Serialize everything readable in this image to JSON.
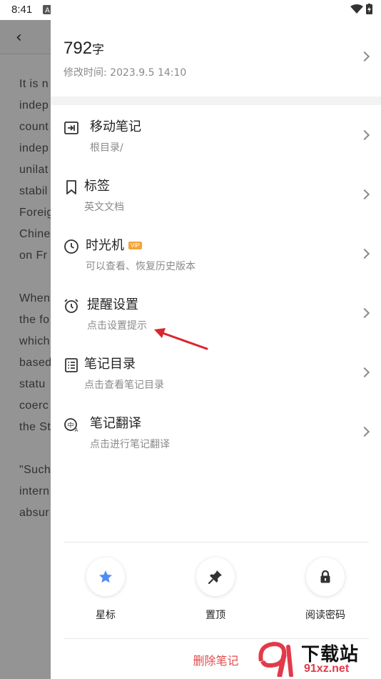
{
  "status_bar": {
    "time": "8:41"
  },
  "background_note": {
    "lines": [
      "It is n",
      "indep",
      "count",
      "indep",
      "unilat",
      "stabil",
      "Foreig",
      "Chine",
      "on Fr",
      "",
      "When",
      "the fo",
      "which",
      "based",
      "statu",
      "coerc",
      "the St",
      "",
      "\"Such",
      "intern",
      "absur"
    ]
  },
  "drawer": {
    "word_count": "792",
    "word_unit": "字",
    "modified_label": "修改时间:",
    "modified_time": "2023.9.5 14:10",
    "menu": [
      {
        "title": "移动笔记",
        "subtitle": "根目录/"
      },
      {
        "title": "标签",
        "subtitle": "英文文档"
      },
      {
        "title": "时光机",
        "badge": "VIP",
        "subtitle": "可以查看、恢复历史版本"
      },
      {
        "title": "提醒设置",
        "subtitle": "点击设置提示"
      },
      {
        "title": "笔记目录",
        "subtitle": "点击查看笔记目录"
      },
      {
        "title": "笔记翻译",
        "subtitle": "点击进行笔记翻译"
      }
    ],
    "actions": [
      {
        "label": "星标",
        "icon": "star-icon"
      },
      {
        "label": "置顶",
        "icon": "pin-icon"
      },
      {
        "label": "阅读密码",
        "icon": "lock-icon"
      }
    ],
    "delete_label": "删除笔记"
  },
  "watermark": {
    "main": "下载站",
    "url": "91xz.net"
  },
  "colors": {
    "accent_star": "#4f8cf7",
    "vip_badge": "#f5a33a",
    "delete_red": "#e24b4b",
    "arrow_red": "#d9262c"
  }
}
